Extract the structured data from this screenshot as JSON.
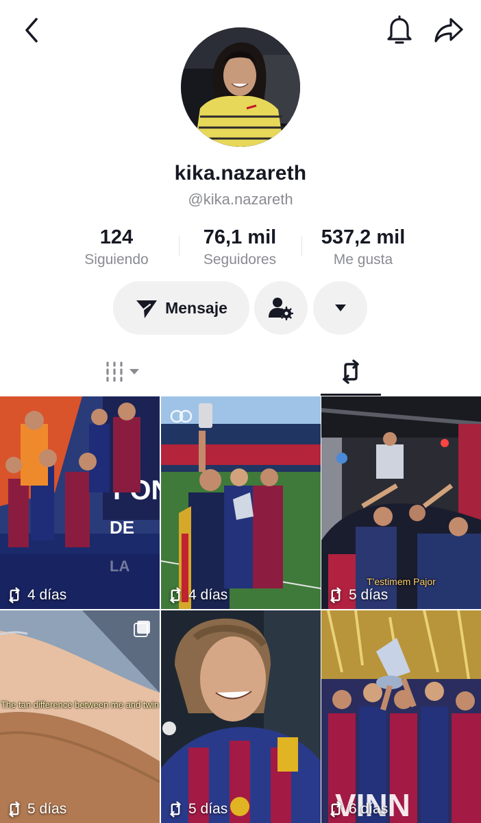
{
  "header": {
    "back_icon": "chevron-left-icon",
    "bell_icon": "bell-icon",
    "share_icon": "share-arrow-icon"
  },
  "profile": {
    "username": "kika.nazareth",
    "handle": "@kika.nazareth"
  },
  "stats": [
    {
      "value": "124",
      "label": "Siguiendo"
    },
    {
      "value": "76,1 mil",
      "label": "Seguidores"
    },
    {
      "value": "537,2 mil",
      "label": "Me gusta"
    }
  ],
  "actions": {
    "message_label": "Mensaje",
    "message_icon": "paper-plane-icon",
    "user_settings_icon": "user-gear-icon",
    "more_icon": "caret-down-icon"
  },
  "tabs": {
    "grid_icon": "video-grid-icon",
    "repost_icon": "repost-icon",
    "active": "repost"
  },
  "posts": [
    {
      "time": "4 días",
      "overlay": ""
    },
    {
      "time": "4 días",
      "overlay": ""
    },
    {
      "time": "5 días",
      "overlay": "T'estimem Pajor"
    },
    {
      "time": "5 días",
      "overlay": "The tan difference between me and twin"
    },
    {
      "time": "5 días",
      "overlay": ""
    },
    {
      "time": "6 días",
      "overlay": ""
    }
  ],
  "colors": {
    "text": "#161823",
    "muted": "#8a8b91",
    "button_bg": "#f1f1f2",
    "barca_blue": "#1b2a6b",
    "barca_red": "#a3123a"
  }
}
